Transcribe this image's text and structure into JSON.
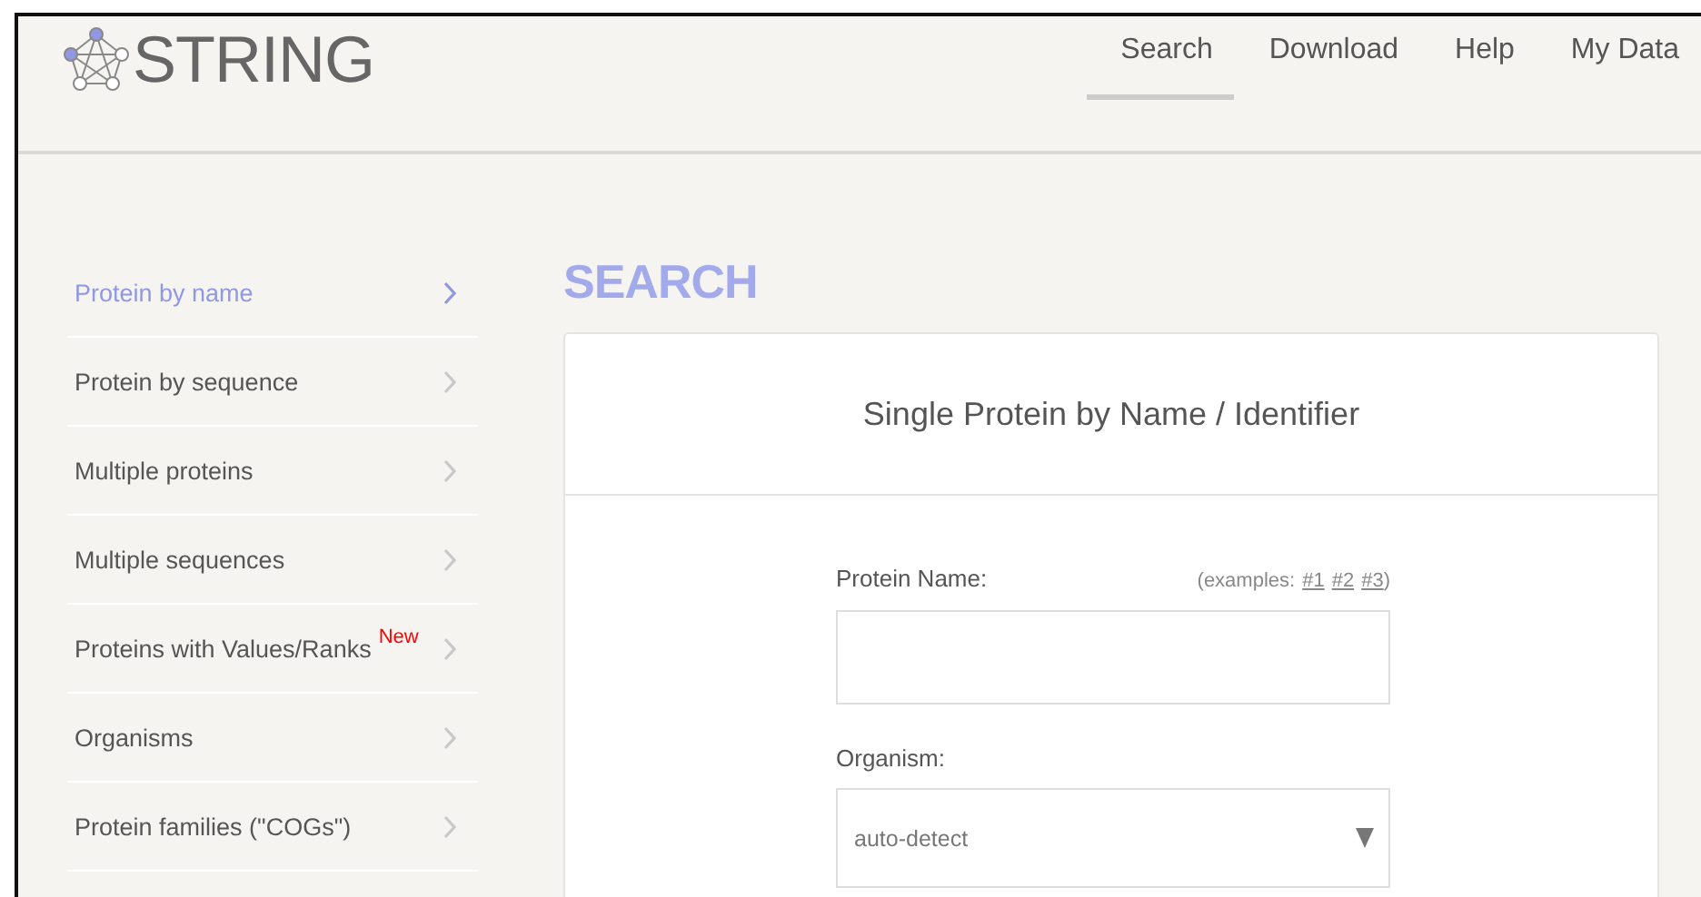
{
  "header": {
    "logo": "STRING",
    "nav": [
      {
        "label": "Search",
        "selected": true
      },
      {
        "label": "Download",
        "selected": false
      },
      {
        "label": "Help",
        "selected": false
      },
      {
        "label": "My Data",
        "selected": false
      }
    ]
  },
  "sidebar": {
    "items": [
      {
        "label": "Protein by name",
        "selected": true
      },
      {
        "label": "Protein by sequence",
        "selected": false
      },
      {
        "label": "Multiple proteins",
        "selected": false
      },
      {
        "label": "Multiple sequences",
        "selected": false
      },
      {
        "label": "Proteins with Values/Ranks",
        "badge": "New",
        "selected": false
      },
      {
        "label": "Organisms",
        "selected": false
      },
      {
        "label": "Protein families (\"COGs\")",
        "selected": false
      }
    ]
  },
  "main": {
    "title": "SEARCH",
    "card_title": "Single Protein by Name / Identifier",
    "protein_label": "Protein Name:",
    "examples_prefix": "(examples:",
    "examples": [
      "#1",
      "#2",
      "#3"
    ],
    "examples_suffix": ")",
    "organism_label": "Organism:",
    "organism_value": "auto-detect"
  }
}
